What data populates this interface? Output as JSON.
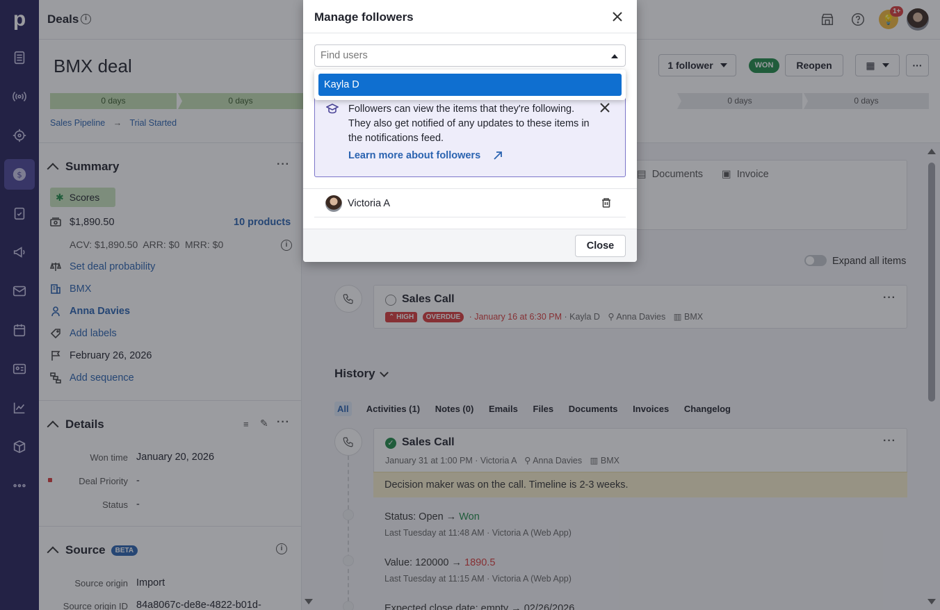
{
  "header": {
    "title": "Deals",
    "notification_badge": "1+"
  },
  "deal": {
    "name": "BMX deal",
    "stages": [
      "0 days",
      "0 days",
      "0 days",
      "0 days"
    ],
    "breadcrumb": [
      "Sales Pipeline",
      "Trial Started"
    ],
    "followers_button": "1 follower",
    "status_badge": "WON",
    "reopen_button": "Reopen"
  },
  "summary": {
    "heading": "Summary",
    "scores_label": "Scores",
    "value": "$1,890.50",
    "products": "10 products",
    "recurring": "ACV: $1,890.50  ARR: $0  MRR: $0",
    "probability": "Set deal probability",
    "organization": "BMX",
    "person": "Anna Davies",
    "labels": "Add labels",
    "close_date": "February 26, 2026",
    "sequence": "Add sequence"
  },
  "details": {
    "heading": "Details",
    "rows": [
      {
        "label": "Won time",
        "value": "January 20, 2026"
      },
      {
        "label": "Deal Priority",
        "value": "-"
      },
      {
        "label": "Status",
        "value": "-"
      }
    ]
  },
  "source": {
    "heading": "Source",
    "badge": "BETA",
    "rows": [
      {
        "label": "Source origin",
        "value": "Import"
      },
      {
        "label": "Source origin ID",
        "value": "84a8067c-de8e-4822-b01d-"
      }
    ]
  },
  "content_tabs": {
    "documents": "Documents",
    "invoice": "Invoice"
  },
  "expand_all": "Expand all items",
  "focus_activity": {
    "title": "Sales Call",
    "priority": "HIGH",
    "overdue": "OVERDUE",
    "due": "January 16 at 6:30 PM",
    "owner": "Kayla D",
    "person": "Anna Davies",
    "org": "BMX"
  },
  "history": {
    "heading": "History",
    "tabs": [
      "All",
      "Activities (1)",
      "Notes (0)",
      "Emails",
      "Files",
      "Documents",
      "Invoices",
      "Changelog"
    ],
    "activity": {
      "title": "Sales Call",
      "date": "January 31 at 1:00 PM",
      "owner": "Victoria A",
      "person": "Anna Davies",
      "org": "BMX",
      "note": "Decision maker was on the call. Timeline is 2-3 weeks."
    },
    "changes": [
      {
        "field": "Status",
        "from": "Open",
        "to": "Won",
        "meta": "Last Tuesday at 11:48 AM · Victoria A (Web App)"
      },
      {
        "field": "Value",
        "from": "120000",
        "to": "1890.5",
        "meta": "Last Tuesday at 11:15 AM · Victoria A (Web App)"
      },
      {
        "field": "Expected close date",
        "from": "empty",
        "to": "02/26/2026",
        "meta": ""
      }
    ]
  },
  "modal": {
    "title": "Manage followers",
    "search_placeholder": "Find users",
    "dropdown_option": "Kayla D",
    "info_text": "Followers can view the items that they're following. They also get notified of any updates to these items in the notifications feed.",
    "info_link": "Learn more about followers",
    "followers": [
      {
        "name": "Victoria A"
      }
    ],
    "close_button": "Close"
  },
  "colors": {
    "nav_bg": "#26215a",
    "accent_blue": "#2a63b0",
    "won_green": "#1f8b47",
    "stage_done": "#c3dfb3",
    "dropdown_highlight": "#0f6fd0"
  }
}
